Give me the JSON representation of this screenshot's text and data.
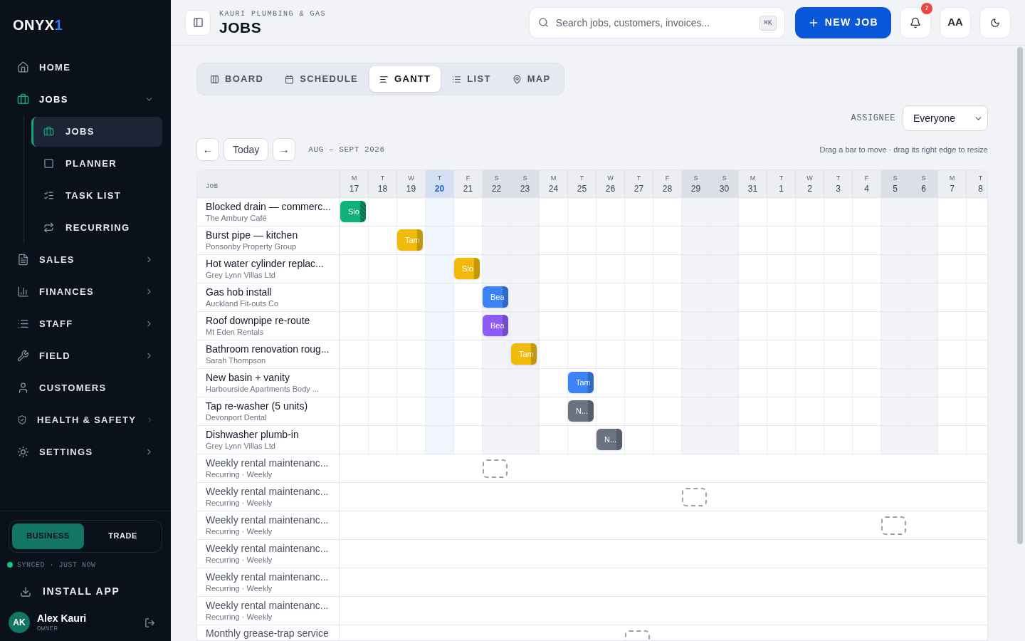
{
  "sidebar": {
    "logo": "ONYX",
    "logo_accent": "1",
    "items": [
      {
        "label": "HOME",
        "kind": "link",
        "selected": false
      },
      {
        "label": "JOBS",
        "kind": "group",
        "selected": true,
        "expanded": true,
        "children": [
          {
            "label": "JOBS",
            "selected": true
          },
          {
            "label": "PLANNER",
            "selected": false
          },
          {
            "label": "TASK LIST",
            "selected": false
          },
          {
            "label": "RECURRING",
            "selected": false
          }
        ]
      },
      {
        "label": "SALES",
        "kind": "group",
        "selected": false,
        "expanded": false
      },
      {
        "label": "FINANCES",
        "kind": "group",
        "selected": false,
        "expanded": false
      },
      {
        "label": "STAFF",
        "kind": "group",
        "selected": false,
        "expanded": false
      },
      {
        "label": "FIELD",
        "kind": "group",
        "selected": false,
        "expanded": false
      },
      {
        "label": "CUSTOMERS",
        "kind": "link",
        "selected": false
      },
      {
        "label": "HEALTH & SAFETY",
        "kind": "group",
        "selected": false,
        "expanded": false
      },
      {
        "label": "SETTINGS",
        "kind": "group",
        "selected": false,
        "expanded": false
      }
    ],
    "mode_toggle": [
      {
        "label": "BUSINESS",
        "selected": true
      },
      {
        "label": "TRADE",
        "selected": false
      }
    ],
    "sync_status": "SYNCED · JUST NOW",
    "synced": true,
    "install": "INSTALL APP",
    "user": {
      "initials": "AK",
      "name": "Alex Kauri",
      "role": "OWNER"
    }
  },
  "header": {
    "company": "KAURI PLUMBING & GAS",
    "title": "JOBS",
    "search": {
      "placeholder": "Search jobs, customers, invoices...",
      "shortcut": "⌘K"
    },
    "new_button": "NEW JOB",
    "notifications": "7",
    "text_size": "AA"
  },
  "view_tabs": [
    {
      "label": "BOARD",
      "selected": false
    },
    {
      "label": "SCHEDULE",
      "selected": false
    },
    {
      "label": "GANTT",
      "selected": true
    },
    {
      "label": "LIST",
      "selected": false
    },
    {
      "label": "MAP",
      "selected": false
    }
  ],
  "assignee": {
    "label": "ASSIGNEE",
    "value": "Everyone"
  },
  "nav": {
    "prev": "←",
    "today": "Today",
    "next": "→",
    "range": "AUG – SEPT 2026",
    "hint": "Drag a bar to move · drag its right edge to resize"
  },
  "gantt": {
    "job_header": "JOB",
    "days": [
      {
        "weekday": "M",
        "date": "17",
        "weekend": false,
        "today": false
      },
      {
        "weekday": "T",
        "date": "18",
        "weekend": false,
        "today": false
      },
      {
        "weekday": "W",
        "date": "19",
        "weekend": false,
        "today": false
      },
      {
        "weekday": "T",
        "date": "20",
        "weekend": false,
        "today": true
      },
      {
        "weekday": "F",
        "date": "21",
        "weekend": false,
        "today": false
      },
      {
        "weekday": "S",
        "date": "22",
        "weekend": true,
        "today": false
      },
      {
        "weekday": "S",
        "date": "23",
        "weekend": true,
        "today": false
      },
      {
        "weekday": "M",
        "date": "24",
        "weekend": false,
        "today": false
      },
      {
        "weekday": "T",
        "date": "25",
        "weekend": false,
        "today": false
      },
      {
        "weekday": "W",
        "date": "26",
        "weekend": false,
        "today": false
      },
      {
        "weekday": "T",
        "date": "27",
        "weekend": false,
        "today": false
      },
      {
        "weekday": "F",
        "date": "28",
        "weekend": false,
        "today": false
      },
      {
        "weekday": "S",
        "date": "29",
        "weekend": true,
        "today": false
      },
      {
        "weekday": "S",
        "date": "30",
        "weekend": true,
        "today": false
      },
      {
        "weekday": "M",
        "date": "31",
        "weekend": false,
        "today": false
      },
      {
        "weekday": "T",
        "date": "1",
        "weekend": false,
        "today": false
      },
      {
        "weekday": "W",
        "date": "2",
        "weekend": false,
        "today": false
      },
      {
        "weekday": "T",
        "date": "3",
        "weekend": false,
        "today": false
      },
      {
        "weekday": "F",
        "date": "4",
        "weekend": false,
        "today": false
      },
      {
        "weekday": "S",
        "date": "5",
        "weekend": true,
        "today": false
      },
      {
        "weekday": "S",
        "date": "6",
        "weekend": true,
        "today": false
      },
      {
        "weekday": "M",
        "date": "7",
        "weekend": false,
        "today": false
      },
      {
        "weekday": "T",
        "date": "8",
        "weekend": false,
        "today": false
      }
    ],
    "rows": [
      {
        "kind": "job",
        "title": "Blocked drain — commerc...",
        "customer": "The Ambury Café",
        "bar": {
          "kind": "scheduled",
          "label": "Sio",
          "color": "#10b07a",
          "hatched": true
        }
      },
      {
        "kind": "job",
        "title": "Burst pipe — kitchen",
        "customer": "Ponsonby Property Group",
        "bar": {
          "kind": "scheduled",
          "label": "Tam",
          "color": "#f0b90b",
          "hatched": false
        }
      },
      {
        "kind": "job",
        "title": "Hot water cylinder replac...",
        "customer": "Grey Lynn Villas Ltd",
        "bar": {
          "kind": "scheduled",
          "label": "Sio",
          "color": "#f0b90b",
          "hatched": false
        }
      },
      {
        "kind": "job",
        "title": "Gas hob install",
        "customer": "Auckland Fit-outs Co",
        "bar": {
          "kind": "scheduled",
          "label": "Bea",
          "color": "#3b82f6",
          "hatched": false
        }
      },
      {
        "kind": "job",
        "title": "Roof downpipe re-route",
        "customer": "Mt Eden Rentals",
        "bar": {
          "kind": "scheduled",
          "label": "Bea",
          "color": "#8b5cf6",
          "hatched": false
        }
      },
      {
        "kind": "job",
        "title": "Bathroom renovation roug...",
        "customer": "Sarah Thompson",
        "bar": {
          "kind": "scheduled",
          "label": "Tam",
          "color": "#f0b90b",
          "hatched": false
        }
      },
      {
        "kind": "job",
        "title": "New basin + vanity",
        "customer": "Harbourside Apartments Body ...",
        "bar": {
          "kind": "scheduled",
          "label": "Tam",
          "color": "#3b82f6",
          "hatched": false
        }
      },
      {
        "kind": "job",
        "title": "Tap re-washer (5 units)",
        "customer": "Devonport Dental",
        "bar": {
          "kind": "scheduled",
          "label": "N...",
          "color": "#6b7280",
          "hatched": false
        }
      },
      {
        "kind": "job",
        "title": "Dishwasher plumb-in",
        "customer": "Grey Lynn Villas Ltd",
        "bar": {
          "kind": "scheduled",
          "label": "N...",
          "color": "#6b7280",
          "hatched": false
        }
      },
      {
        "kind": "recurring",
        "title": "Weekly rental maintenanc...",
        "customer": "Recurring · Weekly",
        "bar": {
          "kind": "placeholder"
        }
      },
      {
        "kind": "recurring",
        "title": "Weekly rental maintenanc...",
        "customer": "Recurring · Weekly",
        "bar": {
          "kind": "placeholder"
        }
      },
      {
        "kind": "recurring",
        "title": "Weekly rental maintenanc...",
        "customer": "Recurring · Weekly",
        "bar": {
          "kind": "placeholder"
        }
      },
      {
        "kind": "recurring",
        "title": "Weekly rental maintenanc...",
        "customer": "Recurring · Weekly"
      },
      {
        "kind": "recurring",
        "title": "Weekly rental maintenanc...",
        "customer": "Recurring · Weekly"
      },
      {
        "kind": "recurring",
        "title": "Weekly rental maintenanc...",
        "customer": "Recurring · Weekly"
      },
      {
        "kind": "recurring",
        "title": "Monthly grease-trap service",
        "bar": {
          "kind": "placeholder"
        }
      }
    ]
  }
}
